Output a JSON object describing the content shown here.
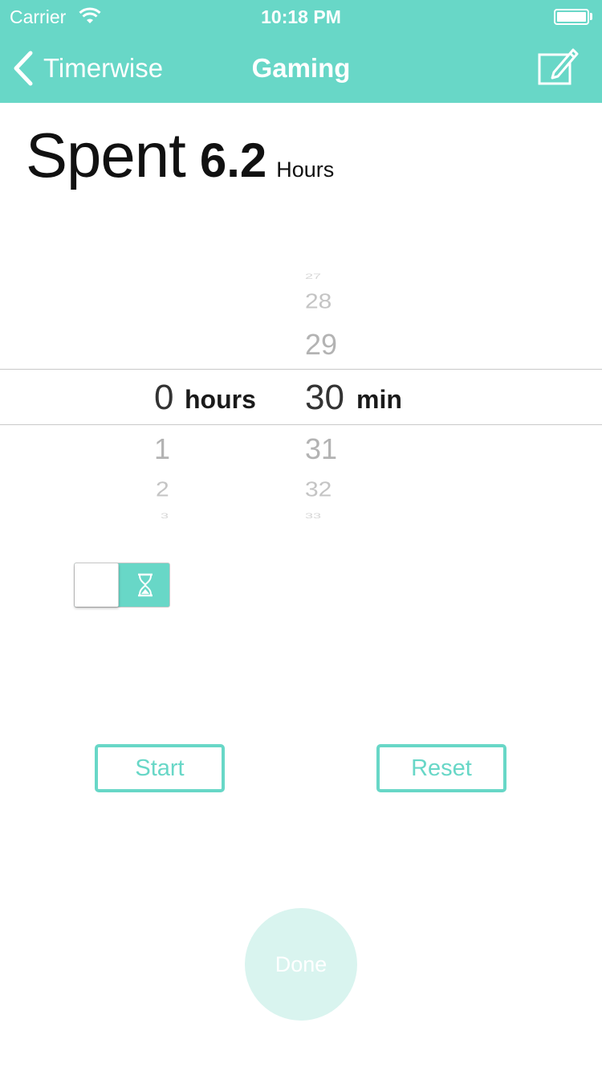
{
  "status_bar": {
    "carrier": "Carrier",
    "time": "10:18 PM"
  },
  "nav": {
    "back_label": "Timerwise",
    "title": "Gaming"
  },
  "spent": {
    "label": "Spent",
    "value": "6.2",
    "unit": "Hours"
  },
  "picker": {
    "hours": {
      "above": [],
      "selected": "0",
      "unit": "hours",
      "below": [
        "1",
        "2",
        "3"
      ]
    },
    "minutes": {
      "above": [
        "27",
        "28",
        "29"
      ],
      "selected": "30",
      "unit": "min",
      "below": [
        "31",
        "32",
        "33"
      ]
    }
  },
  "toggle": {
    "icon": "hourglass-icon",
    "state": "timer"
  },
  "buttons": {
    "start": "Start",
    "reset": "Reset",
    "done": "Done"
  },
  "colors": {
    "accent": "#68d7c7",
    "done_bg": "#d9f4ef"
  }
}
